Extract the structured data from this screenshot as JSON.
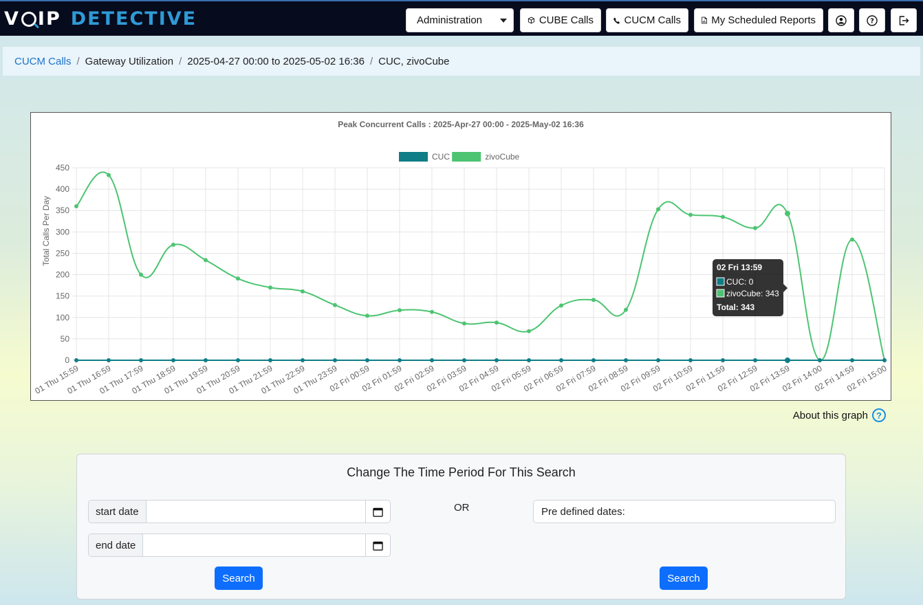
{
  "header": {
    "logo_part1": "VOIP",
    "logo_part2": "DETECTIVE",
    "nav": {
      "administration": "Administration",
      "cube_calls": "CUBE Calls",
      "cucm_calls": "CUCM Calls",
      "scheduled_reports": "My Scheduled Reports"
    }
  },
  "breadcrumb": {
    "link": "CUCM Calls",
    "item1": "Gateway Utilization",
    "item2": "2025-04-27 00:00 to 2025-05-02 16:36",
    "item3": "CUC, zivoCube"
  },
  "chart_data": {
    "type": "line",
    "title": "Peak Concurrent Calls : 2025-Apr-27 00:00 - 2025-May-02 16:36",
    "ylabel": "Total Calls Per Day",
    "xlabel": "",
    "ylim": [
      0,
      450
    ],
    "yticks": [
      0,
      50,
      100,
      150,
      200,
      250,
      300,
      350,
      400,
      450
    ],
    "grid": true,
    "legend_position": "top-center",
    "categories": [
      "01 Thu 15:59",
      "01 Thu 16:59",
      "01 Thu 17:59",
      "01 Thu 18:59",
      "01 Thu 19:59",
      "01 Thu 20:59",
      "01 Thu 21:59",
      "01 Thu 22:59",
      "01 Thu 23:59",
      "02 Fri 00:59",
      "02 Fri 01:59",
      "02 Fri 02:59",
      "02 Fri 03:59",
      "02 Fri 04:59",
      "02 Fri 05:59",
      "02 Fri 06:59",
      "02 Fri 07:59",
      "02 Fri 08:59",
      "02 Fri 09:59",
      "02 Fri 10:59",
      "02 Fri 11:59",
      "02 Fri 12:59",
      "02 Fri 13:59",
      "02 Fri 14:00",
      "02 Fri 14:59",
      "02 Fri 15:00"
    ],
    "series": [
      {
        "name": "CUC",
        "color": "#0e7d86",
        "values": [
          0,
          0,
          0,
          0,
          0,
          0,
          0,
          0,
          0,
          0,
          0,
          0,
          0,
          0,
          0,
          0,
          0,
          0,
          0,
          0,
          0,
          0,
          0,
          0,
          0,
          0
        ]
      },
      {
        "name": "zivoCube",
        "color": "#4cc471",
        "values": [
          360,
          433,
          200,
          270,
          234,
          191,
          170,
          161,
          129,
          104,
          117,
          113,
          86,
          88,
          68,
          128,
          141,
          118,
          353,
          340,
          335,
          309,
          343,
          0,
          282,
          0
        ]
      }
    ],
    "tooltip": {
      "title": "02 Fri 13:59",
      "line1": "CUC: 0",
      "line2": "zivoCube: 343",
      "total": "Total: 343",
      "index": 22
    }
  },
  "about_graph": "About this graph",
  "search_card": {
    "title": "Change The Time Period For This Search",
    "start_label": "start date",
    "end_label": "end date",
    "start_value": "",
    "end_value": "",
    "or_text": "OR",
    "predefined_label": "Pre defined dates:",
    "search_button": "Search",
    "search_button2": "Search"
  }
}
